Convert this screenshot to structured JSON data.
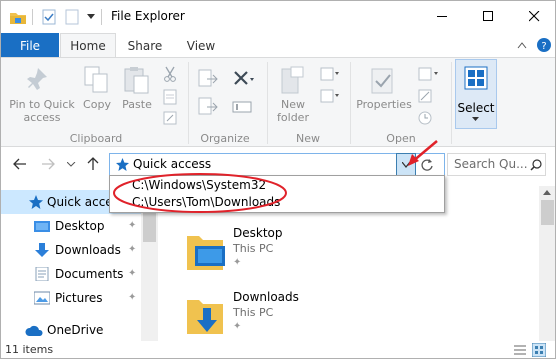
{
  "window": {
    "title": "File Explorer"
  },
  "ribbon_tabs": {
    "file": "File",
    "home": "Home",
    "share": "Share",
    "view": "View"
  },
  "ribbon": {
    "pin_to_quick_access": [
      "Pin to Quick",
      "access"
    ],
    "copy": "Copy",
    "paste": "Paste",
    "new_folder": [
      "New",
      "folder"
    ],
    "properties": "Properties",
    "select": "Select",
    "groups": {
      "clipboard": "Clipboard",
      "organize": "Organize",
      "new": "New",
      "open": "Open"
    }
  },
  "address_bar": {
    "current": "Quick access"
  },
  "search": {
    "placeholder": "Search Qu..."
  },
  "address_dropdown": {
    "items": [
      "C:\\Windows\\System32",
      "C:\\Users\\Tom\\Downloads"
    ]
  },
  "nav_pane": {
    "items": [
      {
        "label": "Quick access",
        "icon": "star-icon"
      },
      {
        "label": "Desktop",
        "icon": "desktop-folder-icon"
      },
      {
        "label": "Downloads",
        "icon": "downloads-icon"
      },
      {
        "label": "Documents",
        "icon": "documents-icon"
      },
      {
        "label": "Pictures",
        "icon": "pictures-icon"
      },
      {
        "label": "OneDrive",
        "icon": "onedrive-icon"
      }
    ]
  },
  "content": {
    "tiles": [
      {
        "name": "Desktop",
        "location": "This PC"
      },
      {
        "name": "Downloads",
        "location": "This PC"
      }
    ]
  },
  "status_bar": {
    "count": "11 items"
  },
  "colors": {
    "accent": "#1a6fc4",
    "annotation": "#e0222a",
    "folder": "#f0c24f"
  }
}
